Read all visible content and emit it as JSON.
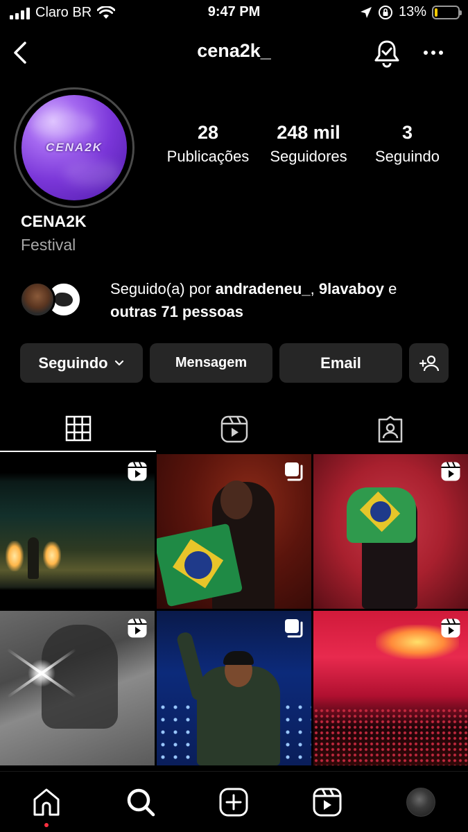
{
  "status_bar": {
    "carrier": "Claro BR",
    "time": "9:47 PM",
    "battery": "13%",
    "battery_level": 0.13,
    "battery_color": "#ffcc00",
    "icons": [
      "signal-icon",
      "wifi-icon",
      "location-icon",
      "orientation-lock-icon",
      "battery-icon"
    ]
  },
  "header": {
    "username": "cena2k_",
    "icons": [
      "back-arrow-icon",
      "notification-bell-icon",
      "more-options-icon"
    ]
  },
  "profile": {
    "avatar_text": "CENA2K",
    "name": "CENA2K",
    "category": "Festival",
    "stats": [
      {
        "value": "28",
        "label": "Publicações"
      },
      {
        "value": "248 mil",
        "label": "Seguidores"
      },
      {
        "value": "3",
        "label": "Seguindo"
      }
    ]
  },
  "followed_by": {
    "prefix": "Seguido(a) por ",
    "user1": "andradeneu_",
    "separator": ", ",
    "user2": "9lavaboy",
    "connector": " e",
    "others": "outras 71 pessoas"
  },
  "actions": {
    "following": "Seguindo",
    "message": "Mensagem",
    "email": "Email",
    "add_user_icon": "add-user-icon"
  },
  "tabs": [
    {
      "name": "posts-grid",
      "icon": "grid-icon",
      "active": true
    },
    {
      "name": "reels",
      "icon": "reels-icon",
      "active": false
    },
    {
      "name": "tagged",
      "icon": "tagged-icon",
      "active": false
    }
  ],
  "posts": [
    {
      "type": "reel",
      "icon": "reels-icon"
    },
    {
      "type": "carousel",
      "icon": "carousel-icon"
    },
    {
      "type": "reel",
      "icon": "reels-icon"
    },
    {
      "type": "reel",
      "icon": "reels-icon"
    },
    {
      "type": "carousel",
      "icon": "carousel-icon"
    },
    {
      "type": "reel",
      "icon": "reels-icon"
    }
  ],
  "bottom_nav": {
    "items": [
      "home-icon",
      "search-icon",
      "create-post-icon",
      "reels-icon",
      "profile-avatar"
    ],
    "notification_dot_color": "#ff3040"
  }
}
